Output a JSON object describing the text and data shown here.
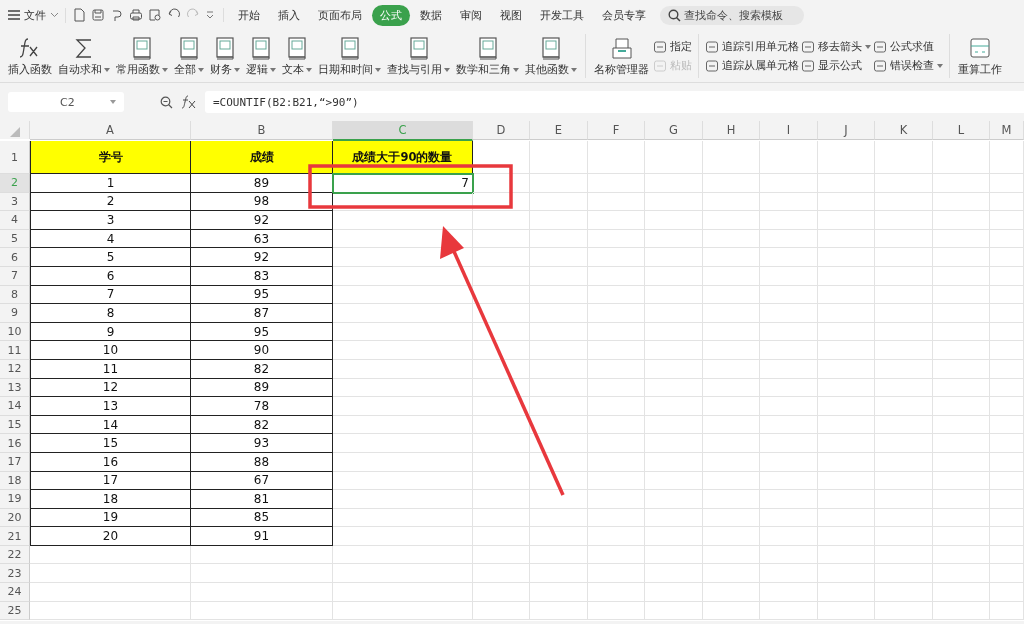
{
  "menu": {
    "label": "文件"
  },
  "tabs": [
    {
      "label": "开始",
      "selected": false
    },
    {
      "label": "插入",
      "selected": false
    },
    {
      "label": "页面布局",
      "selected": false
    },
    {
      "label": "公式",
      "selected": true
    },
    {
      "label": "数据",
      "selected": false
    },
    {
      "label": "审阅",
      "selected": false
    },
    {
      "label": "视图",
      "selected": false
    },
    {
      "label": "开发工具",
      "selected": false
    },
    {
      "label": "会员专享",
      "selected": false
    }
  ],
  "search": {
    "placeholder": "查找命令、搜索模板"
  },
  "ribbon": [
    {
      "label": "插入函数",
      "kind": "fx",
      "dropdown": false
    },
    {
      "label": "自动求和",
      "kind": "sum",
      "dropdown": true
    },
    {
      "label": "常用函数",
      "kind": "book",
      "dropdown": true
    },
    {
      "label": "全部",
      "kind": "book",
      "dropdown": true
    },
    {
      "label": "财务",
      "kind": "book",
      "dropdown": true
    },
    {
      "label": "逻辑",
      "kind": "book",
      "dropdown": true
    },
    {
      "label": "文本",
      "kind": "book",
      "dropdown": true
    },
    {
      "label": "日期和时间",
      "kind": "book",
      "dropdown": true
    },
    {
      "label": "查找与引用",
      "kind": "book",
      "dropdown": true
    },
    {
      "label": "数学和三角",
      "kind": "book",
      "dropdown": true
    },
    {
      "label": "其他函数",
      "kind": "book",
      "dropdown": true
    },
    {
      "label": "名称管理器",
      "kind": "tray",
      "dropdown": false
    }
  ],
  "small_tools": [
    [
      {
        "label": "指定",
        "dropdown": false,
        "disabled": false
      },
      {
        "label": "粘贴",
        "dropdown": false,
        "disabled": true
      }
    ],
    [
      {
        "label": "追踪引用单元格",
        "dropdown": false,
        "disabled": false
      },
      {
        "label": "追踪从属单元格",
        "dropdown": false,
        "disabled": false
      }
    ],
    [
      {
        "label": "移去箭头",
        "dropdown": true,
        "disabled": false
      },
      {
        "label": "显示公式",
        "dropdown": false,
        "disabled": false
      }
    ],
    [
      {
        "label": "公式求值",
        "dropdown": false,
        "disabled": false
      },
      {
        "label": "错误检查",
        "dropdown": true,
        "disabled": false
      }
    ]
  ],
  "recalc": {
    "label": "重算工作"
  },
  "name_box": "C2",
  "formula": "=COUNTIF(B2:B21,“>90”)",
  "columns": [
    {
      "label": "A",
      "selected": false
    },
    {
      "label": "B",
      "selected": false
    },
    {
      "label": "C",
      "selected": true
    },
    {
      "label": "D",
      "selected": false
    },
    {
      "label": "E",
      "selected": false
    },
    {
      "label": "F",
      "selected": false
    },
    {
      "label": "G",
      "selected": false
    },
    {
      "label": "H",
      "selected": false
    },
    {
      "label": "I",
      "selected": false
    },
    {
      "label": "J",
      "selected": false
    },
    {
      "label": "K",
      "selected": false
    },
    {
      "label": "L",
      "selected": false
    },
    {
      "label": "M",
      "selected": false
    }
  ],
  "rows": [
    {
      "number": "1",
      "kind": "header",
      "selected": false,
      "cells": [
        "学号",
        "成绩",
        "成绩大于90的数量"
      ]
    },
    {
      "number": "2",
      "kind": "data",
      "selected": true,
      "cells": [
        "1",
        "89",
        "7"
      ]
    },
    {
      "number": "3",
      "kind": "data",
      "selected": false,
      "cells": [
        "2",
        "98"
      ]
    },
    {
      "number": "4",
      "kind": "data",
      "selected": false,
      "cells": [
        "3",
        "92"
      ]
    },
    {
      "number": "5",
      "kind": "data",
      "selected": false,
      "cells": [
        "4",
        "63"
      ]
    },
    {
      "number": "6",
      "kind": "data",
      "selected": false,
      "cells": [
        "5",
        "92"
      ]
    },
    {
      "number": "7",
      "kind": "data",
      "selected": false,
      "cells": [
        "6",
        "83"
      ]
    },
    {
      "number": "8",
      "kind": "data",
      "selected": false,
      "cells": [
        "7",
        "95"
      ]
    },
    {
      "number": "9",
      "kind": "data",
      "selected": false,
      "cells": [
        "8",
        "87"
      ]
    },
    {
      "number": "10",
      "kind": "data",
      "selected": false,
      "cells": [
        "9",
        "95"
      ]
    },
    {
      "number": "11",
      "kind": "data",
      "selected": false,
      "cells": [
        "10",
        "90"
      ]
    },
    {
      "number": "12",
      "kind": "data",
      "selected": false,
      "cells": [
        "11",
        "82"
      ]
    },
    {
      "number": "13",
      "kind": "data",
      "selected": false,
      "cells": [
        "12",
        "89"
      ]
    },
    {
      "number": "14",
      "kind": "data",
      "selected": false,
      "cells": [
        "13",
        "78"
      ]
    },
    {
      "number": "15",
      "kind": "data",
      "selected": false,
      "cells": [
        "14",
        "82"
      ]
    },
    {
      "number": "16",
      "kind": "data",
      "selected": false,
      "cells": [
        "15",
        "93"
      ]
    },
    {
      "number": "17",
      "kind": "data",
      "selected": false,
      "cells": [
        "16",
        "88"
      ]
    },
    {
      "number": "18",
      "kind": "data",
      "selected": false,
      "cells": [
        "17",
        "67"
      ]
    },
    {
      "number": "19",
      "kind": "data",
      "selected": false,
      "cells": [
        "18",
        "81"
      ]
    },
    {
      "number": "20",
      "kind": "data",
      "selected": false,
      "cells": [
        "19",
        "85"
      ]
    },
    {
      "number": "21",
      "kind": "data",
      "selected": false,
      "cells": [
        "20",
        "91"
      ]
    },
    {
      "number": "22",
      "kind": "empty",
      "selected": false,
      "cells": []
    },
    {
      "number": "23",
      "kind": "empty",
      "selected": false,
      "cells": []
    },
    {
      "number": "24",
      "kind": "empty",
      "selected": false,
      "cells": []
    },
    {
      "number": "25",
      "kind": "empty",
      "selected": false,
      "cells": []
    }
  ]
}
